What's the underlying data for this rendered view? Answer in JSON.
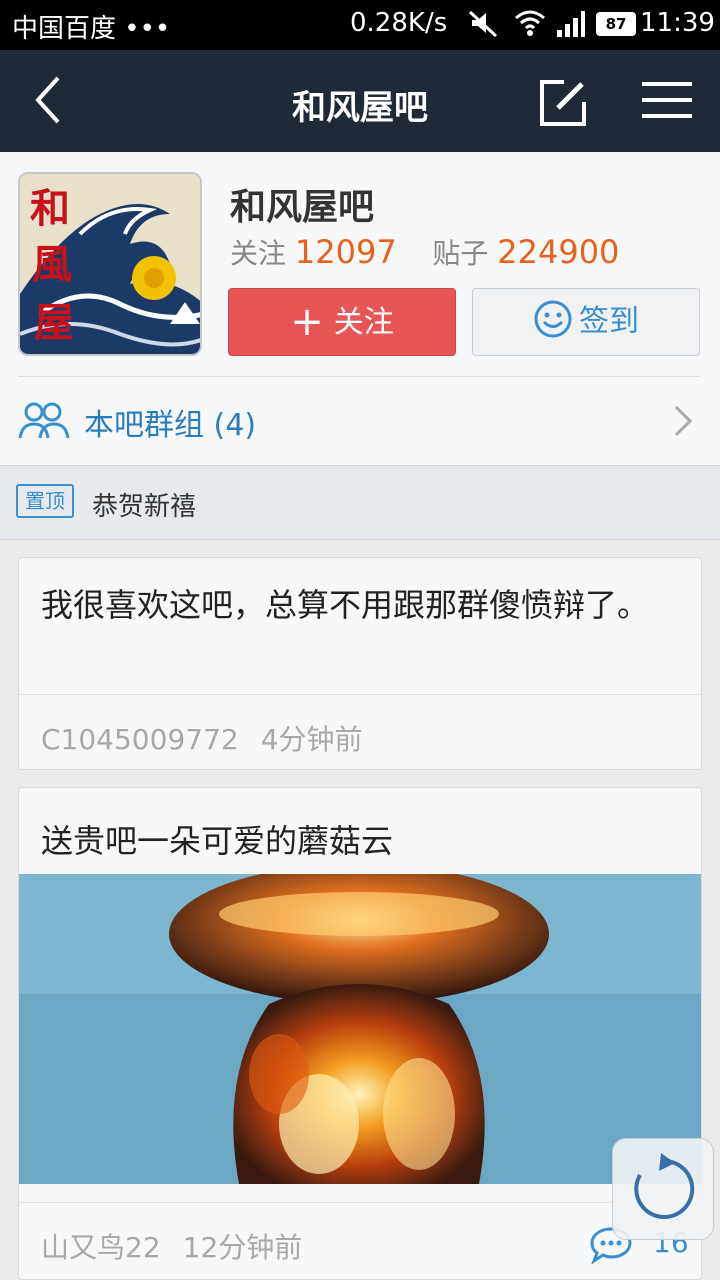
{
  "status_bar": {
    "carrier": "中国百度 •••",
    "speed": "0.28K/s",
    "battery": "87",
    "time": "11:39"
  },
  "navbar": {
    "title": "和风屋吧"
  },
  "forum": {
    "name": "和风屋吧",
    "follow_label": "关注",
    "follow_count": "12097",
    "posts_label": "贴子",
    "posts_count": "224900",
    "follow_button": "关注",
    "sign_button": "签到",
    "group_label": "本吧群组 (4)",
    "avatar_text": [
      "和",
      "風",
      "屋"
    ]
  },
  "pinned": {
    "badge": "置顶",
    "text": "恭贺新禧"
  },
  "threads": [
    {
      "title": "我很喜欢这吧，总算不用跟那群傻愤辩了。",
      "author": "C1045009772",
      "time": "4分钟前"
    },
    {
      "title": "送贵吧一朵可爱的蘑菇云",
      "author": "山又鸟22",
      "time": "12分钟前",
      "reply_count": "16"
    }
  ],
  "colors": {
    "navbar_bg": "#1f2a36",
    "accent_blue": "#3a8fd0",
    "accent_orange": "#e8621e",
    "follow_red": "#e85555"
  }
}
